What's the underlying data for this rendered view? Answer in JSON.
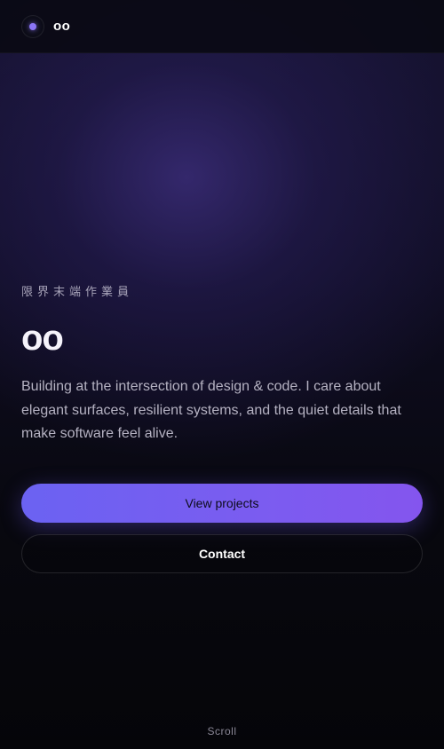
{
  "header": {
    "brand": "oo",
    "logo_icon": "dot-logo-icon"
  },
  "hero": {
    "eyebrow": "限界末端作業員",
    "title": "oo",
    "lead": "Building at the intersection of design & code. I care about elegant surfaces, resilient systems, and the quiet details that make software feel alive."
  },
  "actions": {
    "primary_label": "View projects",
    "secondary_label": "Contact"
  },
  "footer": {
    "scroll_label": "Scroll"
  },
  "colors": {
    "accent": "#7b5cf0",
    "background": "#07070d"
  }
}
